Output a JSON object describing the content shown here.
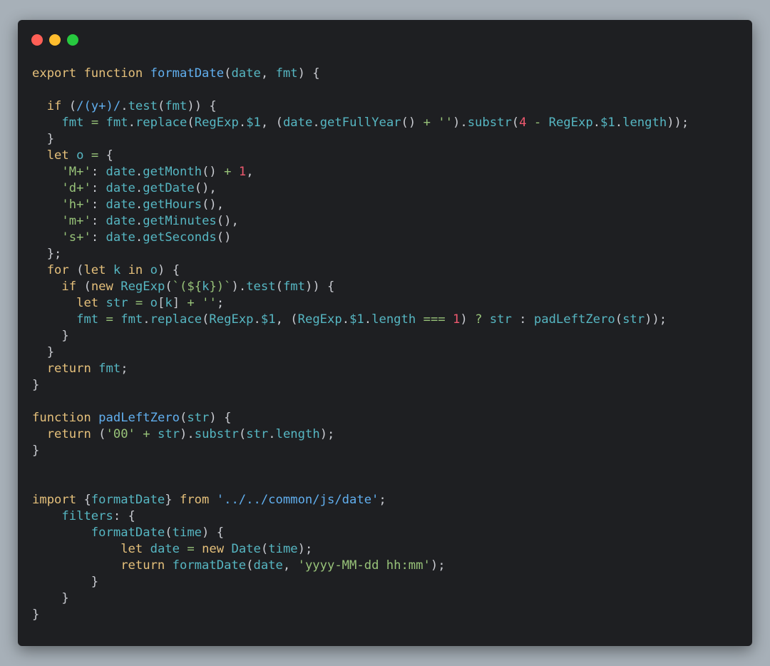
{
  "colors": {
    "background": "#a7b0b8",
    "editor": "#1e1f22",
    "keyword": "#e5c07b",
    "function": "#61afef",
    "identifier": "#56b6c2",
    "string": "#98c379",
    "number": "#ef596f",
    "plain": "#c9cbd1"
  },
  "window_controls": [
    "close",
    "minimize",
    "maximize"
  ],
  "code_lines": [
    [
      [
        "kw",
        "export"
      ],
      [
        "pl",
        " "
      ],
      [
        "kw",
        "function"
      ],
      [
        "pl",
        " "
      ],
      [
        "fn",
        "formatDate"
      ],
      [
        "pl",
        "("
      ],
      [
        "pr",
        "date"
      ],
      [
        "pl",
        ", "
      ],
      [
        "pr",
        "fmt"
      ],
      [
        "pl",
        ") {"
      ]
    ],
    [],
    [
      [
        "pl",
        "  "
      ],
      [
        "kw",
        "if"
      ],
      [
        "pl",
        " ("
      ],
      [
        "fn",
        "/(y+)/"
      ],
      [
        "pl",
        "."
      ],
      [
        "pr",
        "test"
      ],
      [
        "pl",
        "("
      ],
      [
        "pr",
        "fmt"
      ],
      [
        "pl",
        ")) {"
      ]
    ],
    [
      [
        "pl",
        "    "
      ],
      [
        "pr",
        "fmt"
      ],
      [
        "pl",
        " "
      ],
      [
        "op",
        "="
      ],
      [
        "pl",
        " "
      ],
      [
        "pr",
        "fmt"
      ],
      [
        "pl",
        "."
      ],
      [
        "pr",
        "replace"
      ],
      [
        "pl",
        "("
      ],
      [
        "pr",
        "RegExp"
      ],
      [
        "pl",
        "."
      ],
      [
        "pr",
        "$1"
      ],
      [
        "pl",
        ", ("
      ],
      [
        "pr",
        "date"
      ],
      [
        "pl",
        "."
      ],
      [
        "pr",
        "getFullYear"
      ],
      [
        "pl",
        "() "
      ],
      [
        "op",
        "+"
      ],
      [
        "pl",
        " "
      ],
      [
        "st",
        "''"
      ],
      [
        "pl",
        ")."
      ],
      [
        "pr",
        "substr"
      ],
      [
        "pl",
        "("
      ],
      [
        "nu",
        "4"
      ],
      [
        "pl",
        " "
      ],
      [
        "op",
        "-"
      ],
      [
        "pl",
        " "
      ],
      [
        "pr",
        "RegExp"
      ],
      [
        "pl",
        "."
      ],
      [
        "pr",
        "$1"
      ],
      [
        "pl",
        "."
      ],
      [
        "pr",
        "length"
      ],
      [
        "pl",
        "));"
      ]
    ],
    [
      [
        "pl",
        "  }"
      ]
    ],
    [
      [
        "pl",
        "  "
      ],
      [
        "kw",
        "let"
      ],
      [
        "pl",
        " "
      ],
      [
        "pr",
        "o"
      ],
      [
        "pl",
        " "
      ],
      [
        "op",
        "="
      ],
      [
        "pl",
        " {"
      ]
    ],
    [
      [
        "pl",
        "    "
      ],
      [
        "st",
        "'M+'"
      ],
      [
        "pl",
        ": "
      ],
      [
        "pr",
        "date"
      ],
      [
        "pl",
        "."
      ],
      [
        "pr",
        "getMonth"
      ],
      [
        "pl",
        "() "
      ],
      [
        "op",
        "+"
      ],
      [
        "pl",
        " "
      ],
      [
        "nu",
        "1"
      ],
      [
        "pl",
        ","
      ]
    ],
    [
      [
        "pl",
        "    "
      ],
      [
        "st",
        "'d+'"
      ],
      [
        "pl",
        ": "
      ],
      [
        "pr",
        "date"
      ],
      [
        "pl",
        "."
      ],
      [
        "pr",
        "getDate"
      ],
      [
        "pl",
        "(),"
      ]
    ],
    [
      [
        "pl",
        "    "
      ],
      [
        "st",
        "'h+'"
      ],
      [
        "pl",
        ": "
      ],
      [
        "pr",
        "date"
      ],
      [
        "pl",
        "."
      ],
      [
        "pr",
        "getHours"
      ],
      [
        "pl",
        "(),"
      ]
    ],
    [
      [
        "pl",
        "    "
      ],
      [
        "st",
        "'m+'"
      ],
      [
        "pl",
        ": "
      ],
      [
        "pr",
        "date"
      ],
      [
        "pl",
        "."
      ],
      [
        "pr",
        "getMinutes"
      ],
      [
        "pl",
        "(),"
      ]
    ],
    [
      [
        "pl",
        "    "
      ],
      [
        "st",
        "'s+'"
      ],
      [
        "pl",
        ": "
      ],
      [
        "pr",
        "date"
      ],
      [
        "pl",
        "."
      ],
      [
        "pr",
        "getSeconds"
      ],
      [
        "pl",
        "()"
      ]
    ],
    [
      [
        "pl",
        "  };"
      ]
    ],
    [
      [
        "pl",
        "  "
      ],
      [
        "kw",
        "for"
      ],
      [
        "pl",
        " ("
      ],
      [
        "kw",
        "let"
      ],
      [
        "pl",
        " "
      ],
      [
        "pr",
        "k"
      ],
      [
        "pl",
        " "
      ],
      [
        "kw",
        "in"
      ],
      [
        "pl",
        " "
      ],
      [
        "pr",
        "o"
      ],
      [
        "pl",
        ") {"
      ]
    ],
    [
      [
        "pl",
        "    "
      ],
      [
        "kw",
        "if"
      ],
      [
        "pl",
        " ("
      ],
      [
        "kw",
        "new"
      ],
      [
        "pl",
        " "
      ],
      [
        "pr",
        "RegExp"
      ],
      [
        "pl",
        "("
      ],
      [
        "st",
        "`(${"
      ],
      [
        "pr",
        "k"
      ],
      [
        "st",
        "})`"
      ],
      [
        "pl",
        ")."
      ],
      [
        "pr",
        "test"
      ],
      [
        "pl",
        "("
      ],
      [
        "pr",
        "fmt"
      ],
      [
        "pl",
        ")) {"
      ]
    ],
    [
      [
        "pl",
        "      "
      ],
      [
        "kw",
        "let"
      ],
      [
        "pl",
        " "
      ],
      [
        "pr",
        "str"
      ],
      [
        "pl",
        " "
      ],
      [
        "op",
        "="
      ],
      [
        "pl",
        " "
      ],
      [
        "pr",
        "o"
      ],
      [
        "pl",
        "["
      ],
      [
        "pr",
        "k"
      ],
      [
        "pl",
        "] "
      ],
      [
        "op",
        "+"
      ],
      [
        "pl",
        " "
      ],
      [
        "st",
        "''"
      ],
      [
        "pl",
        ";"
      ]
    ],
    [
      [
        "pl",
        "      "
      ],
      [
        "pr",
        "fmt"
      ],
      [
        "pl",
        " "
      ],
      [
        "op",
        "="
      ],
      [
        "pl",
        " "
      ],
      [
        "pr",
        "fmt"
      ],
      [
        "pl",
        "."
      ],
      [
        "pr",
        "replace"
      ],
      [
        "pl",
        "("
      ],
      [
        "pr",
        "RegExp"
      ],
      [
        "pl",
        "."
      ],
      [
        "pr",
        "$1"
      ],
      [
        "pl",
        ", ("
      ],
      [
        "pr",
        "RegExp"
      ],
      [
        "pl",
        "."
      ],
      [
        "pr",
        "$1"
      ],
      [
        "pl",
        "."
      ],
      [
        "pr",
        "length"
      ],
      [
        "pl",
        " "
      ],
      [
        "op",
        "==="
      ],
      [
        "pl",
        " "
      ],
      [
        "nu",
        "1"
      ],
      [
        "pl",
        ") "
      ],
      [
        "op",
        "?"
      ],
      [
        "pl",
        " "
      ],
      [
        "pr",
        "str"
      ],
      [
        "pl",
        " : "
      ],
      [
        "pr",
        "padLeftZero"
      ],
      [
        "pl",
        "("
      ],
      [
        "pr",
        "str"
      ],
      [
        "pl",
        "));"
      ]
    ],
    [
      [
        "pl",
        "    }"
      ]
    ],
    [
      [
        "pl",
        "  }"
      ]
    ],
    [
      [
        "pl",
        "  "
      ],
      [
        "kw",
        "return"
      ],
      [
        "pl",
        " "
      ],
      [
        "pr",
        "fmt"
      ],
      [
        "pl",
        ";"
      ]
    ],
    [
      [
        "pl",
        "}"
      ]
    ],
    [],
    [
      [
        "kw",
        "function"
      ],
      [
        "pl",
        " "
      ],
      [
        "fn",
        "padLeftZero"
      ],
      [
        "pl",
        "("
      ],
      [
        "pr",
        "str"
      ],
      [
        "pl",
        ") {"
      ]
    ],
    [
      [
        "pl",
        "  "
      ],
      [
        "kw",
        "return"
      ],
      [
        "pl",
        " ("
      ],
      [
        "st",
        "'00'"
      ],
      [
        "pl",
        " "
      ],
      [
        "op",
        "+"
      ],
      [
        "pl",
        " "
      ],
      [
        "pr",
        "str"
      ],
      [
        "pl",
        ")."
      ],
      [
        "pr",
        "substr"
      ],
      [
        "pl",
        "("
      ],
      [
        "pr",
        "str"
      ],
      [
        "pl",
        "."
      ],
      [
        "pr",
        "length"
      ],
      [
        "pl",
        ");"
      ]
    ],
    [
      [
        "pl",
        "}"
      ]
    ],
    [],
    [],
    [
      [
        "kw",
        "import"
      ],
      [
        "pl",
        " {"
      ],
      [
        "pr",
        "formatDate"
      ],
      [
        "pl",
        "} "
      ],
      [
        "kw",
        "from"
      ],
      [
        "pl",
        " "
      ],
      [
        "fn",
        "'../../common/js/date'"
      ],
      [
        "pl",
        ";"
      ]
    ],
    [
      [
        "pl",
        "    "
      ],
      [
        "pr",
        "filters"
      ],
      [
        "pl",
        ": {"
      ]
    ],
    [
      [
        "pl",
        "        "
      ],
      [
        "pr",
        "formatDate"
      ],
      [
        "pl",
        "("
      ],
      [
        "pr",
        "time"
      ],
      [
        "pl",
        ") {"
      ]
    ],
    [
      [
        "pl",
        "            "
      ],
      [
        "kw",
        "let"
      ],
      [
        "pl",
        " "
      ],
      [
        "pr",
        "date"
      ],
      [
        "pl",
        " "
      ],
      [
        "op",
        "="
      ],
      [
        "pl",
        " "
      ],
      [
        "kw",
        "new"
      ],
      [
        "pl",
        " "
      ],
      [
        "pr",
        "Date"
      ],
      [
        "pl",
        "("
      ],
      [
        "pr",
        "time"
      ],
      [
        "pl",
        ");"
      ]
    ],
    [
      [
        "pl",
        "            "
      ],
      [
        "kw",
        "return"
      ],
      [
        "pl",
        " "
      ],
      [
        "pr",
        "formatDate"
      ],
      [
        "pl",
        "("
      ],
      [
        "pr",
        "date"
      ],
      [
        "pl",
        ", "
      ],
      [
        "st",
        "'yyyy-MM-dd hh:mm'"
      ],
      [
        "pl",
        ");"
      ]
    ],
    [
      [
        "pl",
        "        }"
      ]
    ],
    [
      [
        "pl",
        "    }"
      ]
    ],
    [
      [
        "pl",
        "}"
      ]
    ]
  ]
}
